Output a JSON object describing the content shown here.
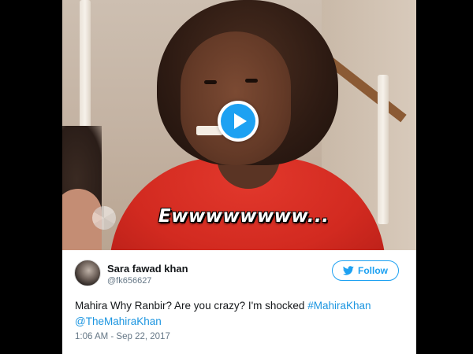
{
  "media": {
    "caption": "Ewwwwwwww...",
    "play_icon": "play-icon"
  },
  "tweet": {
    "author_name": "Sara fawad khan",
    "author_handle": "@fk656627",
    "follow_label": "Follow",
    "text_main": "Mahira Why Ranbir? Are you crazy? I'm shocked ",
    "hashtag": "#MahiraKhan",
    "mention": "@TheMahiraKhan",
    "timestamp": "1:06 AM - Sep 22, 2017"
  },
  "colors": {
    "accent": "#1da1f2",
    "link": "#1b95e0",
    "muted": "#657786"
  }
}
